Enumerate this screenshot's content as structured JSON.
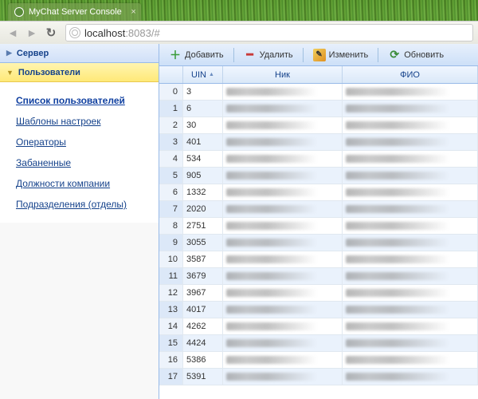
{
  "browser": {
    "tab_title": "MyChat Server Console",
    "url_host": "localhost",
    "url_rest": ":8083/#"
  },
  "sidebar": {
    "server_label": "Сервер",
    "users_label": "Пользователи",
    "menu": [
      {
        "label": "Список пользователей",
        "active": true
      },
      {
        "label": "Шаблоны настроек",
        "active": false
      },
      {
        "label": "Операторы",
        "active": false
      },
      {
        "label": "Забаненные",
        "active": false
      },
      {
        "label": "Должности компании",
        "active": false
      },
      {
        "label": "Подразделения (отделы)",
        "active": false
      }
    ]
  },
  "toolbar": {
    "add": "Добавить",
    "delete": "Удалить",
    "edit": "Изменить",
    "refresh": "Обновить"
  },
  "grid": {
    "headers": {
      "uin": "UIN",
      "nick": "Ник",
      "fio": "ФИО"
    },
    "rows": [
      {
        "idx": "0",
        "uin": "3"
      },
      {
        "idx": "1",
        "uin": "6"
      },
      {
        "idx": "2",
        "uin": "30"
      },
      {
        "idx": "3",
        "uin": "401"
      },
      {
        "idx": "4",
        "uin": "534"
      },
      {
        "idx": "5",
        "uin": "905"
      },
      {
        "idx": "6",
        "uin": "1332"
      },
      {
        "idx": "7",
        "uin": "2020"
      },
      {
        "idx": "8",
        "uin": "2751"
      },
      {
        "idx": "9",
        "uin": "3055"
      },
      {
        "idx": "10",
        "uin": "3587"
      },
      {
        "idx": "11",
        "uin": "3679"
      },
      {
        "idx": "12",
        "uin": "3967"
      },
      {
        "idx": "13",
        "uin": "4017"
      },
      {
        "idx": "14",
        "uin": "4262"
      },
      {
        "idx": "15",
        "uin": "4424"
      },
      {
        "idx": "16",
        "uin": "5386"
      },
      {
        "idx": "17",
        "uin": "5391"
      }
    ]
  }
}
